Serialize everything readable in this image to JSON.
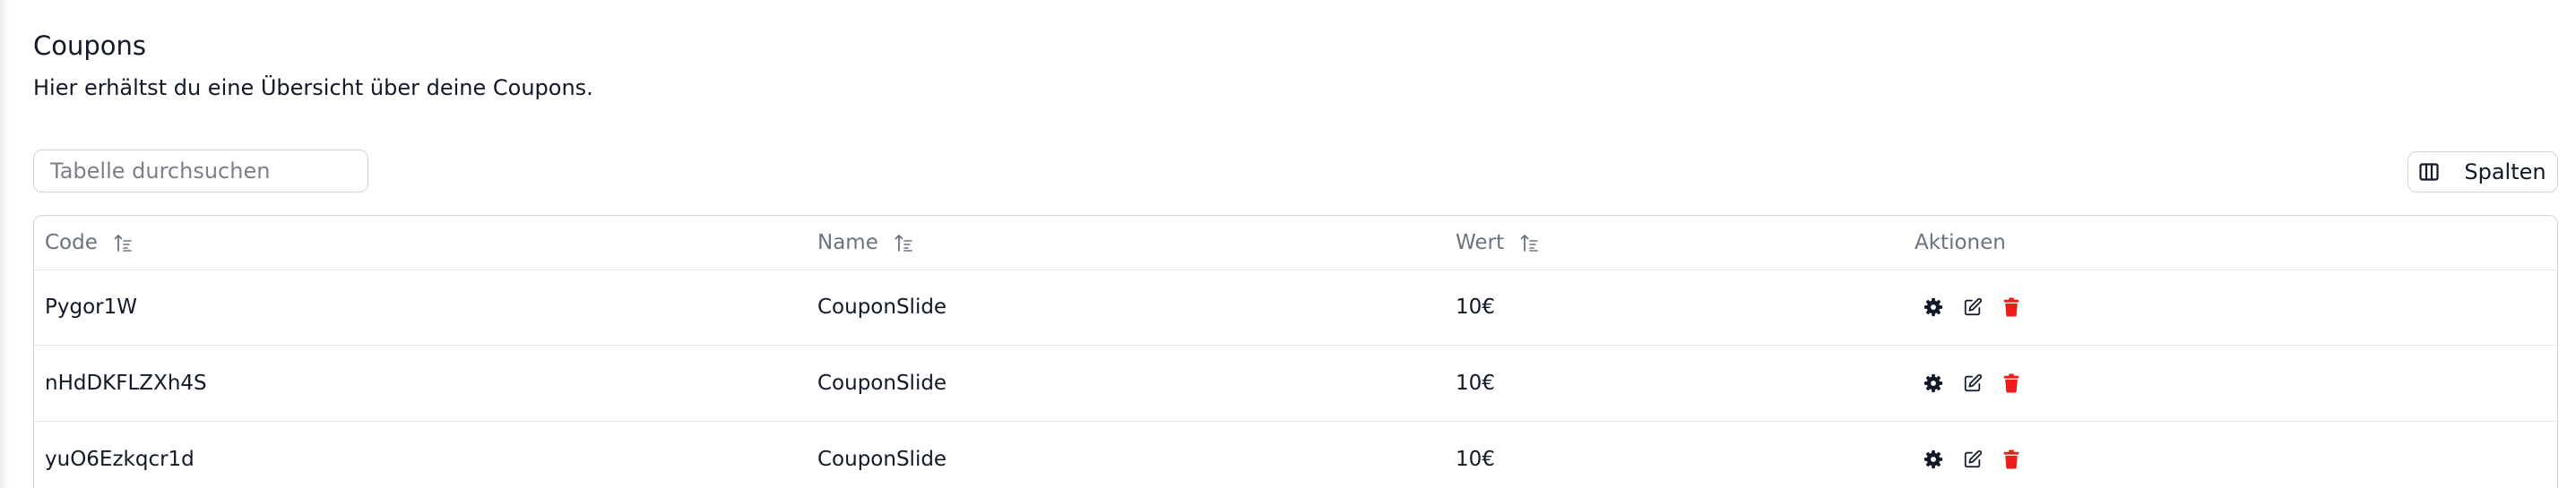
{
  "header": {
    "title": "Coupons",
    "subtitle": "Hier erhältst du eine Übersicht über deine Coupons."
  },
  "toolbar": {
    "search_placeholder": "Tabelle durchsuchen",
    "columns_label": "Spalten"
  },
  "table": {
    "columns": [
      "Code",
      "Name",
      "Wert",
      "Aktionen"
    ],
    "rows": [
      {
        "code": "Pygor1W",
        "name": "CouponSlide",
        "wert": "10€"
      },
      {
        "code": "nHdDKFLZXh4S",
        "name": "CouponSlide",
        "wert": "10€"
      },
      {
        "code": "yuO6Ezkqcr1d",
        "name": "CouponSlide",
        "wert": "10€"
      }
    ],
    "row_actions": [
      "gear-icon",
      "edit-icon",
      "trash-icon"
    ]
  },
  "colors": {
    "text": "#111827",
    "muted": "#6b7280",
    "border": "#d1d5db",
    "delete": "#ef1c1c"
  }
}
